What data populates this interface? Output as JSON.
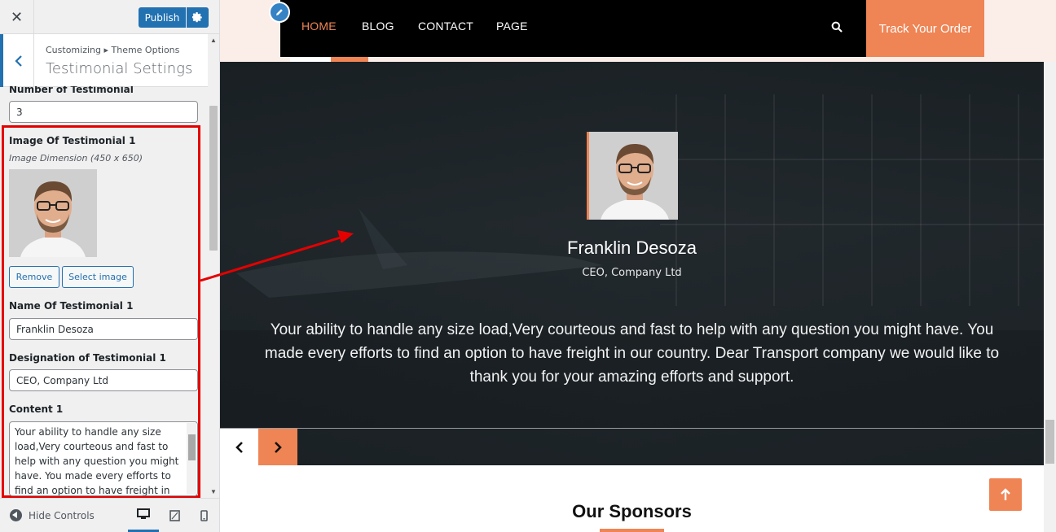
{
  "sidebar": {
    "publish_label": "Publish",
    "breadcrumb": "Customizing ▸ Theme Options",
    "section_title": "Testimonial Settings",
    "number_label": "Number of Testimonial",
    "number_value": "3",
    "image_label": "Image Of Testimonial 1",
    "image_dimension": "Image Dimension (450 x 650)",
    "remove_label": "Remove",
    "select_image_label": "Select image",
    "name_label": "Name Of Testimonial 1",
    "name_value": "Franklin Desoza",
    "designation_label": "Designation of Testimonial 1",
    "designation_value": "CEO, Company Ltd",
    "content_label": "Content 1",
    "content_value": "Your ability to handle any size load,Very courteous and fast to help with any question you might have. You made every efforts to find an option to have freight in our country.",
    "hide_controls_label": "Hide Controls",
    "accent_color": "#2271b1"
  },
  "nav": {
    "items": [
      "HOME",
      "BLOG",
      "CONTACT",
      "PAGE"
    ],
    "track_label": "Track Your Order",
    "accent_color": "#ef8454"
  },
  "testimonial": {
    "name": "Franklin Desoza",
    "designation": "CEO, Company Ltd",
    "quote": "Your ability to handle any size load,Very courteous and fast to help with any question you might have. You made every efforts to find an option to have freight in our country. Dear Transport company we would like to thank you for your amazing efforts and support."
  },
  "sponsors": {
    "title": "Our Sponsors"
  }
}
